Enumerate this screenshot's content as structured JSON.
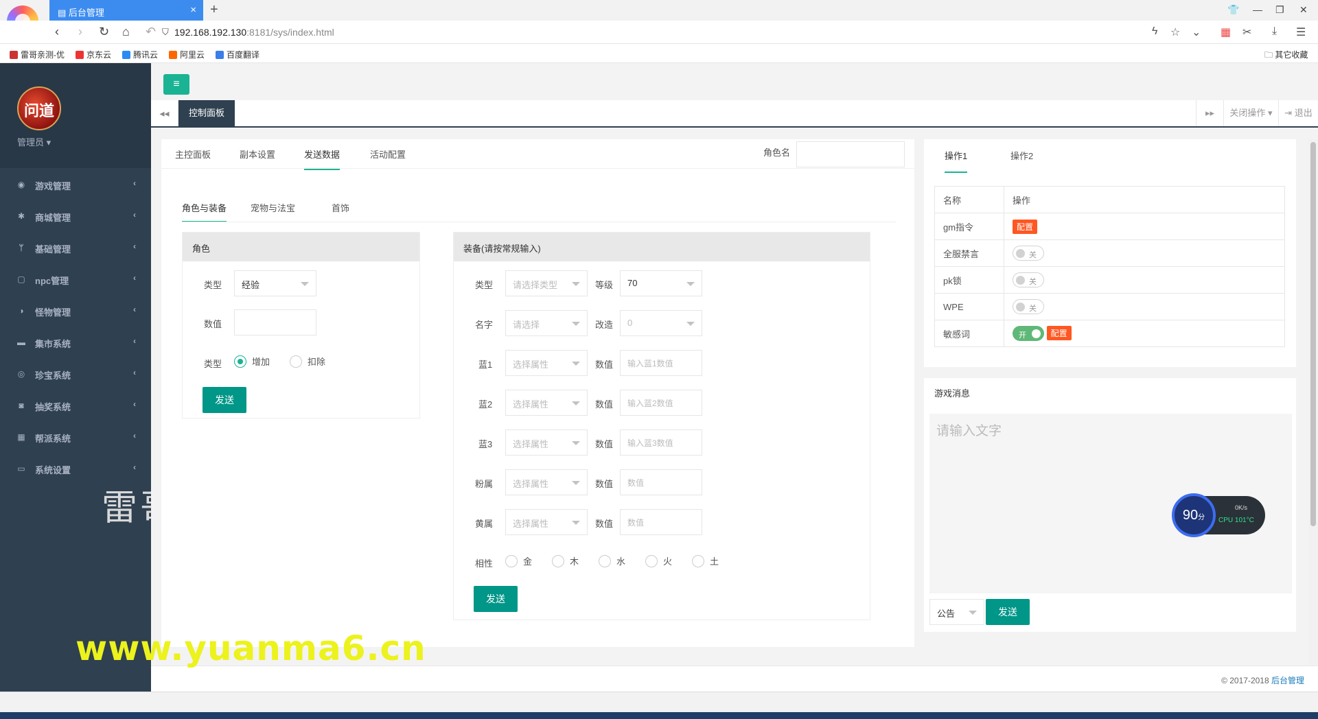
{
  "browser": {
    "tab_title": "后台管理",
    "url_host": "192.168.192.130",
    "url_rest": ":8181/sys/index.html",
    "bookmarks": [
      "雷哥亲测-优",
      "京东云",
      "腾讯云",
      "阿里云",
      "百度翻译"
    ],
    "other_bookmarks": "其它收藏"
  },
  "sidebar": {
    "avatar_text": "问道",
    "admin_label": "管理员",
    "items": [
      {
        "label": "游戏管理",
        "icon": "gamepad-icon"
      },
      {
        "label": "商城管理",
        "icon": "gear-icon"
      },
      {
        "label": "基础管理",
        "icon": "cutlery-icon"
      },
      {
        "label": "npc管理",
        "icon": "square-icon"
      },
      {
        "label": "怪物管理",
        "icon": "adjust-icon"
      },
      {
        "label": "集市系统",
        "icon": "bed-icon"
      },
      {
        "label": "珍宝系统",
        "icon": "disc-icon"
      },
      {
        "label": "抽奖系统",
        "icon": "camera-icon"
      },
      {
        "label": "帮派系统",
        "icon": "grid-icon"
      },
      {
        "label": "系统设置",
        "icon": "desktop-icon"
      }
    ],
    "watermark": "雷哥"
  },
  "tabs_bar": {
    "active_tab": "控制面板",
    "close_ops": "关闭操作",
    "logout": "退出"
  },
  "main": {
    "tabs": [
      "主控面板",
      "副本设置",
      "发送数据",
      "活动配置"
    ],
    "active_tab": "发送数据",
    "role_name_label": "角色名",
    "subtabs": [
      "角色与装备",
      "宠物与法宝",
      "首饰"
    ],
    "role_card": {
      "title": "角色",
      "type_label": "类型",
      "type_value": "经验",
      "value_label": "数值",
      "op_label": "类型",
      "op_add": "增加",
      "op_deduct": "扣除",
      "send": "发送"
    },
    "equip_card": {
      "title": "装备(请按常规输入)",
      "type_label": "类型",
      "type_ph": "请选择类型",
      "level_label": "等级",
      "level_value": "70",
      "name_label": "名字",
      "name_ph": "请选择",
      "modify_label": "改造",
      "modify_value": "0",
      "rows": [
        {
          "label": "蓝1",
          "sel_ph": "选择属性",
          "val_label": "数值",
          "inp_ph": "输入蓝1数值"
        },
        {
          "label": "蓝2",
          "sel_ph": "选择属性",
          "val_label": "数值",
          "inp_ph": "输入蓝2数值"
        },
        {
          "label": "蓝3",
          "sel_ph": "选择属性",
          "val_label": "数值",
          "inp_ph": "输入蓝3数值"
        },
        {
          "label": "粉属",
          "sel_ph": "选择属性",
          "val_label": "数值",
          "inp_ph": "数值"
        },
        {
          "label": "黄属",
          "sel_ph": "选择属性",
          "val_label": "数值",
          "inp_ph": "数值"
        }
      ],
      "element_label": "相性",
      "elements": [
        "金",
        "木",
        "水",
        "火",
        "土"
      ],
      "send": "发送"
    }
  },
  "ops_panel": {
    "tabs": [
      "操作1",
      "操作2"
    ],
    "col_name": "名称",
    "col_op": "操作",
    "rows": [
      {
        "name": "gm指令",
        "tag": "配置"
      },
      {
        "name": "全服禁言",
        "switch": "关"
      },
      {
        "name": "pk锁",
        "switch": "关"
      },
      {
        "name": "WPE",
        "switch": "关"
      },
      {
        "name": "敏感词",
        "switch": "开",
        "tag": "配置"
      }
    ]
  },
  "msg_panel": {
    "title": "游戏消息",
    "placeholder": "请输入文字",
    "type_value": "公告",
    "send": "发送"
  },
  "cpu_widget": {
    "score": "90",
    "unit": "分",
    "net": "0K/s",
    "cpu": "CPU 101°C"
  },
  "footer": {
    "copy": "© 2017-2018",
    "brand": "后台管理"
  },
  "overlay_watermark": "www.yuanma6.cn"
}
